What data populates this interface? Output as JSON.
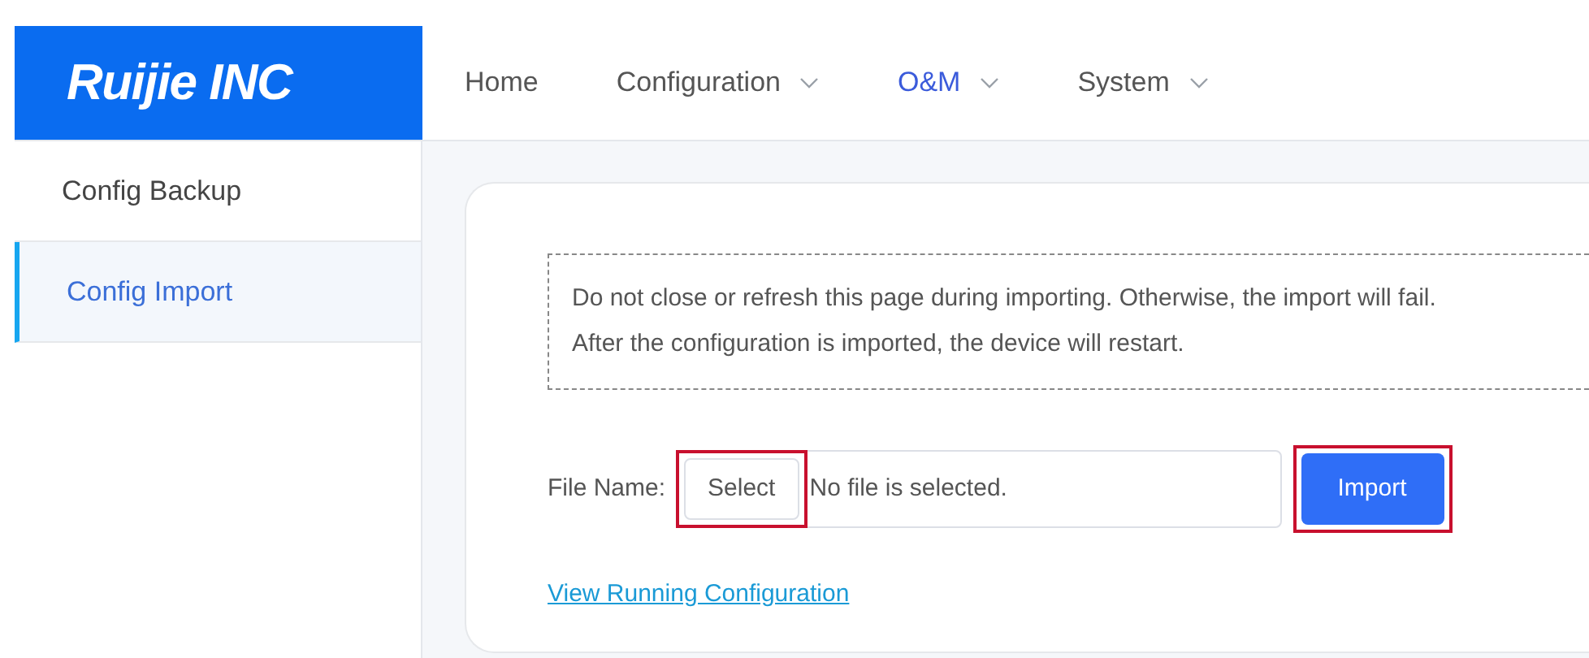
{
  "logo": {
    "text": "Ruijie INC"
  },
  "nav": [
    {
      "label": "Home",
      "selected": false,
      "dropdown": false
    },
    {
      "label": "Configuration",
      "selected": false,
      "dropdown": true
    },
    {
      "label": "O&M",
      "selected": true,
      "dropdown": true
    },
    {
      "label": "System",
      "selected": false,
      "dropdown": true
    }
  ],
  "sidebar": {
    "items": [
      {
        "label": "Config Backup",
        "selected": false
      },
      {
        "label": "Config Import",
        "selected": true
      }
    ]
  },
  "notice": [
    "Do not close or refresh this page during importing. Otherwise, the import will fail.",
    "After the configuration is imported, the device will restart."
  ],
  "file": {
    "label": "File Name:",
    "select_button": {
      "label": "Select",
      "highlighted": true
    },
    "value": "No file is selected."
  },
  "import_button": {
    "label": "Import",
    "highlighted": true
  },
  "link": "View Running Configuration"
}
